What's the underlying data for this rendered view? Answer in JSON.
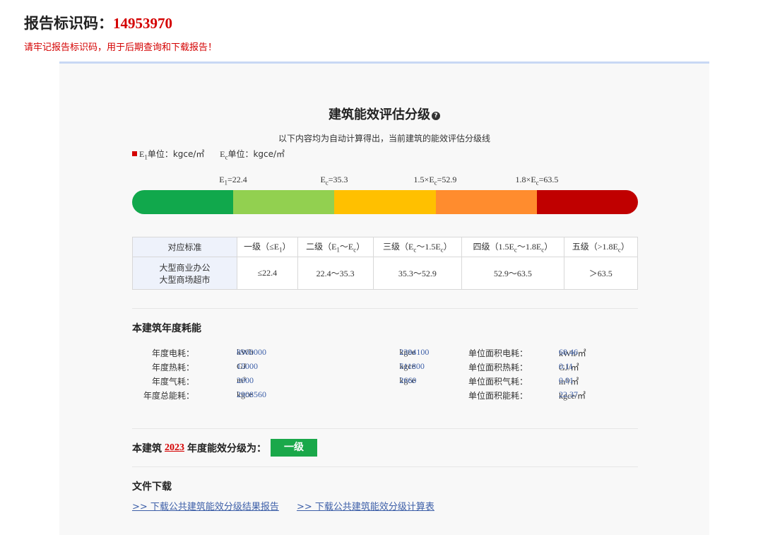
{
  "report": {
    "title_label": "报告标识码：",
    "code": "14953970",
    "warning": "请牢记报告标识码，用于后期查询和下载报告！"
  },
  "panel": {
    "title": "建筑能效评估分级",
    "subtitle": "以下内容均为自动计算得出，当前建筑的能效评估分级线",
    "units": {
      "e1": "E",
      "e1_sub": "1",
      "e1_text": "单位：kgce/㎡",
      "ec": "E",
      "ec_sub": "c",
      "ec_text": "单位：kgce/㎡"
    }
  },
  "thresholds": [
    {
      "prefix": "E",
      "sub": "1",
      "suffix": "=22.4"
    },
    {
      "prefix": "E",
      "sub": "c",
      "suffix": "=35.3"
    },
    {
      "prefix": "1.5×E",
      "sub": "c",
      "suffix": "=52.9"
    },
    {
      "prefix": "1.8×E",
      "sub": "c",
      "suffix": "=63.5"
    }
  ],
  "bar_colors": [
    "#11a84c",
    "#92d050",
    "#ffc000",
    "#ff8c2e",
    "#c00000"
  ],
  "grade_table": {
    "header": [
      {
        "text": "对应标准"
      },
      {
        "parts": [
          "一级（≤E",
          "1",
          "）"
        ]
      },
      {
        "parts": [
          "二级（E",
          "1",
          "～E",
          "c",
          "）"
        ]
      },
      {
        "parts": [
          "三级（E",
          "c",
          "～1.5E",
          "c",
          "）"
        ]
      },
      {
        "parts": [
          "四级（1.5E",
          "c",
          "～1.8E",
          "c",
          "）"
        ]
      },
      {
        "parts": [
          "五级（>1.8E",
          "c",
          "）"
        ]
      }
    ],
    "row_label_line1": "大型商业办公",
    "row_label_line2": "大型商场超市",
    "values": [
      "≤22.4",
      "22.4～35.3",
      "35.3～52.9",
      "52.9～63.5",
      "＞63.5"
    ]
  },
  "annual": {
    "title": "本建筑年度耗能",
    "rows": [
      {
        "label": "年度电耗：",
        "value": "8900000",
        "unit": "kWh",
        "kgce": "2394100",
        "kgce_unit": "kgce",
        "area_label": "单位面积电耗：",
        "area_value": "68.46",
        "area_unit": "kWh/㎡"
      },
      {
        "label": "年度热耗：",
        "value": "15000",
        "unit": "GJ",
        "kgce": "511800",
        "kgce_unit": "kgce",
        "area_label": "单位面积热耗：",
        "area_value": "0.11",
        "area_unit": "GJ/㎡"
      },
      {
        "label": "年度气耗：",
        "value": "2000",
        "unit": "m³",
        "kgce": "2660",
        "kgce_unit": "kgce",
        "area_label": "单位面积气耗：",
        "area_value": "0.01",
        "area_unit": "m³/㎡"
      },
      {
        "label": "年度总能耗：",
        "value": "2908560",
        "unit": "kgce",
        "kgce": "",
        "kgce_unit": "",
        "area_label": "单位面积能耗：",
        "area_value": "22.37",
        "area_unit": "kgce/㎡"
      }
    ]
  },
  "grade_result": {
    "prefix": "本建筑",
    "year": "2023",
    "suffix": "年度能效分级为：",
    "grade": "一级",
    "grade_color": "#1aa84a"
  },
  "downloads": {
    "title": "文件下载",
    "links": [
      ">> 下载公共建筑能效分级结果报告",
      ">> 下载公共建筑能效分级计算表"
    ]
  }
}
